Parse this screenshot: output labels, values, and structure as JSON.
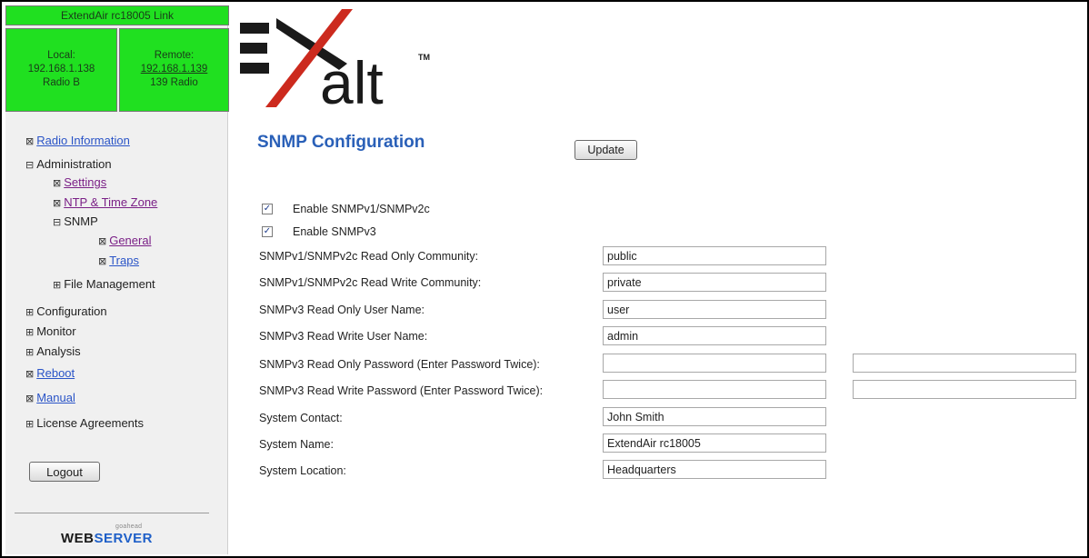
{
  "link": {
    "title": "ExtendAir rc18005 Link",
    "local": {
      "label": "Local:",
      "ip": "192.168.1.138",
      "name": "Radio B"
    },
    "remote": {
      "label": "Remote:",
      "ip": "192.168.1.139",
      "name": "139 Radio"
    }
  },
  "logo": {
    "text": "alt",
    "tm": "TM"
  },
  "sidebar": {
    "radio_information": "Radio Information",
    "administration": "Administration",
    "settings": "Settings",
    "ntp": "NTP & Time Zone",
    "snmp": "SNMP",
    "general": "General",
    "traps": "Traps",
    "file_management": "File Management",
    "configuration": "Configuration",
    "monitor": "Monitor",
    "analysis": "Analysis",
    "reboot": "Reboot",
    "manual": "Manual",
    "license": "License Agreements",
    "logout": "Logout",
    "ws_small": "goahead",
    "ws_web": "WEB",
    "ws_server": "SERVER"
  },
  "main": {
    "title": "SNMP Configuration",
    "update_label": "Update",
    "enable_v1v2c": {
      "label": "Enable SNMPv1/SNMPv2c",
      "checked": true
    },
    "enable_v3": {
      "label": "Enable SNMPv3",
      "checked": true
    },
    "fields": {
      "ro_community": {
        "label": "SNMPv1/SNMPv2c Read Only Community:",
        "value": "public"
      },
      "rw_community": {
        "label": "SNMPv1/SNMPv2c Read Write Community:",
        "value": "private"
      },
      "v3_ro_user": {
        "label": "SNMPv3 Read Only User Name:",
        "value": "user"
      },
      "v3_rw_user": {
        "label": "SNMPv3 Read Write User Name:",
        "value": "admin"
      },
      "v3_ro_password": {
        "label": "SNMPv3 Read Only Password (Enter Password Twice):",
        "value": "",
        "confirm": ""
      },
      "v3_rw_password": {
        "label": "SNMPv3 Read Write Password (Enter Password Twice):",
        "value": "",
        "confirm": ""
      },
      "contact": {
        "label": "System Contact:",
        "value": "John Smith"
      },
      "name": {
        "label": "System Name:",
        "value": "ExtendAir rc18005"
      },
      "location": {
        "label": "System Location:",
        "value": "Headquarters"
      }
    }
  },
  "icons": {
    "expanded": "⊟",
    "collapsed": "⊞",
    "leaf": "⊠",
    "check": "✓"
  },
  "colors": {
    "link_status_green": "#20e020",
    "title_blue": "#2a60b8",
    "link_blue": "#2a54c7",
    "visited_purple": "#7a1f86"
  }
}
